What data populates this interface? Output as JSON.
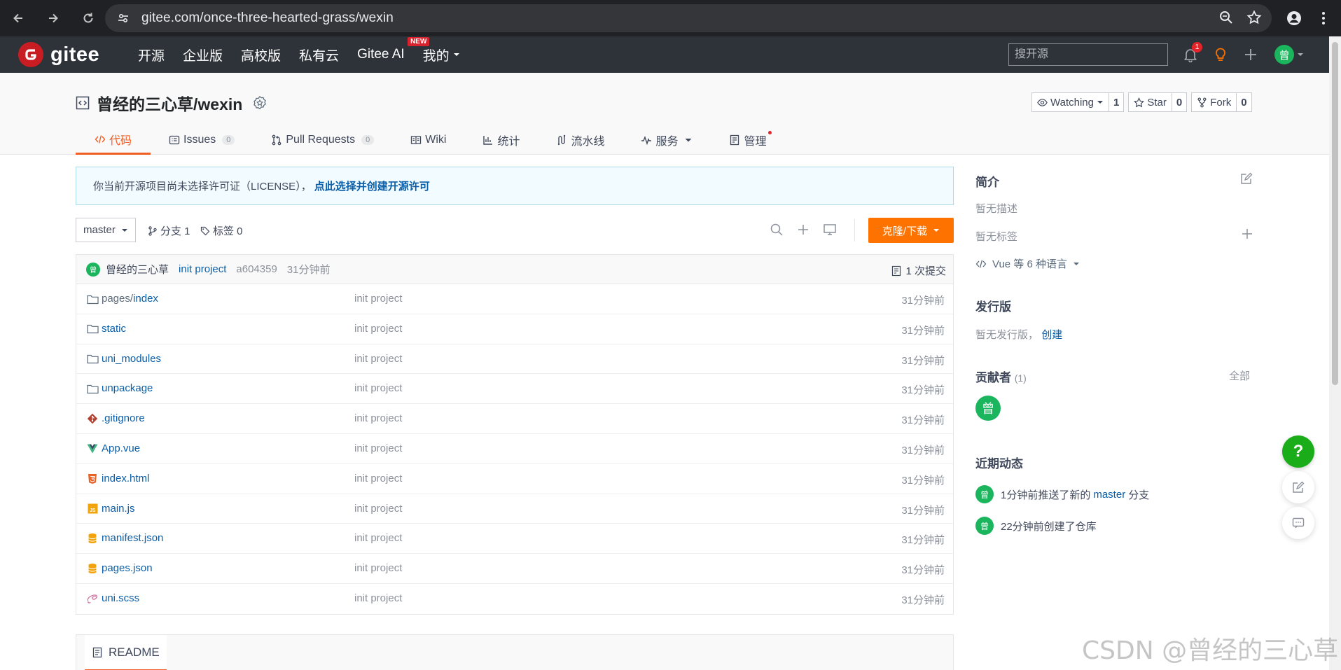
{
  "browser": {
    "url": "gitee.com/once-three-hearted-grass/wexin"
  },
  "header": {
    "logo_text": "gitee",
    "nav": [
      "开源",
      "企业版",
      "高校版",
      "私有云",
      "Gitee AI",
      "我的"
    ],
    "new_badge": "NEW",
    "search_placeholder": "搜开源",
    "notification_count": "1",
    "avatar_char": "曾"
  },
  "repo": {
    "title": "曾经的三心草/wexin",
    "watch_label": "Watching",
    "watch_count": "1",
    "star_label": "Star",
    "star_count": "0",
    "fork_label": "Fork",
    "fork_count": "0",
    "tabs": [
      {
        "label": "代码",
        "icon": "code-icon",
        "active": true
      },
      {
        "label": "Issues",
        "count": "0",
        "icon": "issues-icon"
      },
      {
        "label": "Pull Requests",
        "count": "0",
        "icon": "pull-request-icon"
      },
      {
        "label": "Wiki",
        "icon": "wiki-icon"
      },
      {
        "label": "统计",
        "icon": "stats-icon"
      },
      {
        "label": "流水线",
        "icon": "pipeline-icon"
      },
      {
        "label": "服务",
        "icon": "service-icon"
      },
      {
        "label": "管理",
        "icon": "manage-icon"
      }
    ]
  },
  "license_notice": {
    "text": "你当前开源项目尚未选择许可证（LICENSE），",
    "link": "点此选择并创建开源许可"
  },
  "toolbar": {
    "branch": "master",
    "branches_label": "分支 1",
    "tags_label": "标签 0",
    "clone_label": "克隆/下载"
  },
  "commit": {
    "avatar_char": "曾",
    "author": "曾经的三心草",
    "message": "init project",
    "sha": "a604359",
    "time": "31分钟前",
    "count_label": "1 次提交"
  },
  "files": [
    {
      "dir": "pages/",
      "name": "index",
      "icon": "folder-icon",
      "message": "init project",
      "time": "31分钟前"
    },
    {
      "dir": "",
      "name": "static",
      "icon": "folder-icon",
      "message": "init project",
      "time": "31分钟前"
    },
    {
      "dir": "",
      "name": "uni_modules",
      "icon": "folder-icon",
      "message": "init project",
      "time": "31分钟前"
    },
    {
      "dir": "",
      "name": "unpackage",
      "icon": "folder-icon",
      "message": "init project",
      "time": "31分钟前"
    },
    {
      "dir": "",
      "name": ".gitignore",
      "icon": "git-icon",
      "message": "init project",
      "time": "31分钟前"
    },
    {
      "dir": "",
      "name": "App.vue",
      "icon": "vue-icon",
      "message": "init project",
      "time": "31分钟前"
    },
    {
      "dir": "",
      "name": "index.html",
      "icon": "html5-icon",
      "message": "init project",
      "time": "31分钟前"
    },
    {
      "dir": "",
      "name": "main.js",
      "icon": "js-icon",
      "message": "init project",
      "time": "31分钟前"
    },
    {
      "dir": "",
      "name": "manifest.json",
      "icon": "json-icon",
      "message": "init project",
      "time": "31分钟前"
    },
    {
      "dir": "",
      "name": "pages.json",
      "icon": "json-icon",
      "message": "init project",
      "time": "31分钟前"
    },
    {
      "dir": "",
      "name": "uni.scss",
      "icon": "sass-icon",
      "message": "init project",
      "time": "31分钟前"
    }
  ],
  "readme": {
    "label": "README"
  },
  "sidebar": {
    "intro_title": "简介",
    "no_desc": "暂无描述",
    "no_tags": "暂无标签",
    "languages": "Vue 等 6 种语言",
    "release_title": "发行版",
    "no_release": "暂无发行版，",
    "create_link": "创建",
    "contributors_title": "贡献者",
    "contributors_count": "(1)",
    "all_link": "全部",
    "contributor_char": "曾",
    "activity_title": "近期动态",
    "activities": [
      {
        "avatar": "曾",
        "prefix": "1分钟前推送了新的",
        "link": "master",
        "suffix": "分支"
      },
      {
        "avatar": "曾",
        "prefix": "22分钟前创建了仓库",
        "link": "",
        "suffix": ""
      }
    ]
  },
  "float": {
    "help": "?"
  },
  "watermark": "CSDN @曾经的三心草",
  "colors": {
    "accent": "#f25d23",
    "clone_button": "#fe7300",
    "header_bg": "#2e3339",
    "link": "#0b5ea8",
    "avatar": "#1bb55d",
    "gitee_red": "#c71d23"
  }
}
